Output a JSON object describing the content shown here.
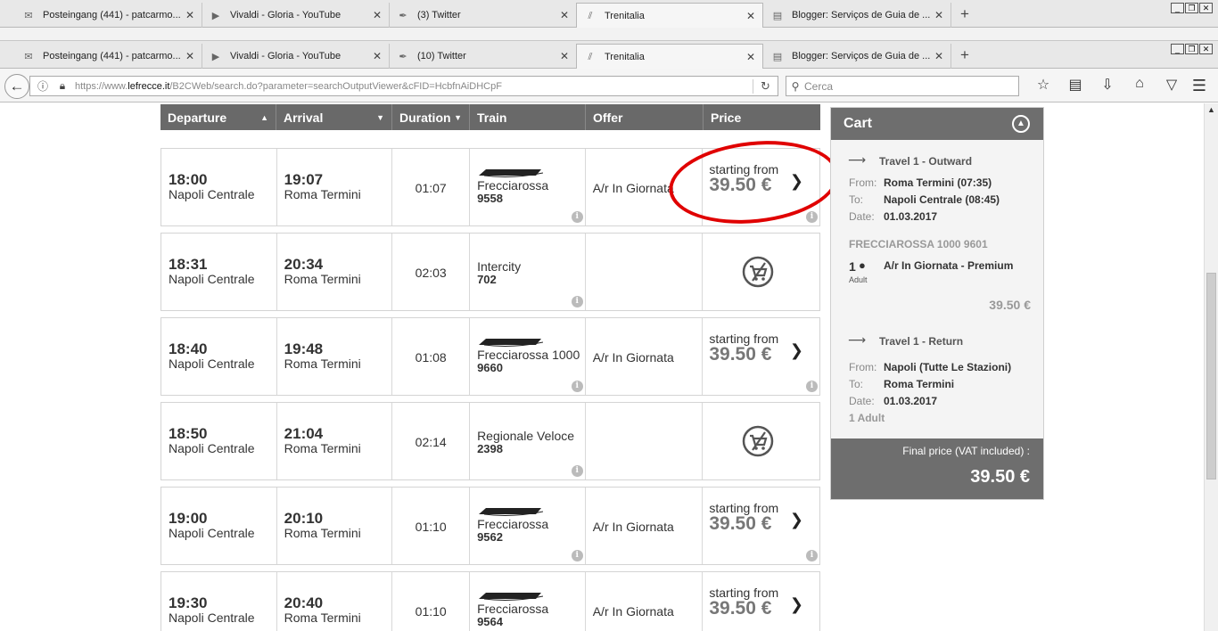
{
  "back_tabs": [
    {
      "title": "Posteingang (441) - patcarmo...",
      "icon": "mail-icon"
    },
    {
      "title": "Vivaldi - Gloria - YouTube",
      "icon": "video-icon"
    },
    {
      "title": "(3) Twitter",
      "icon": "twitter-icon"
    },
    {
      "title": "Trenitalia",
      "icon": "trenitalia-icon"
    },
    {
      "title": "Blogger: Serviços de Guia de ...",
      "icon": "blogger-icon"
    }
  ],
  "front_tabs": [
    {
      "title": "Posteingang (441) - patcarmo...",
      "icon": "mail-icon"
    },
    {
      "title": "Vivaldi - Gloria - YouTube",
      "icon": "video-icon"
    },
    {
      "title": "(10) Twitter",
      "icon": "twitter-icon"
    },
    {
      "title": "Trenitalia",
      "icon": "trenitalia-icon"
    },
    {
      "title": "Blogger: Serviços de Guia de ...",
      "icon": "blogger-icon"
    }
  ],
  "browser": {
    "url_prefix": "https://www.",
    "url_domain": "lefrecce.it",
    "url_rest": "/B2CWeb/search.do?parameter=searchOutputViewer&cFID=HcbfnAiDHCpF",
    "search_placeholder": "Cerca"
  },
  "table": {
    "headers": {
      "departure": "Departure",
      "arrival": "Arrival",
      "duration": "Duration",
      "train": "Train",
      "offer": "Offer",
      "price": "Price"
    },
    "rows": [
      {
        "dep_time": "18:00",
        "dep_station": "Napoli Centrale",
        "arr_time": "19:07",
        "arr_station": "Roma Termini",
        "duration": "01:07",
        "train_name": "Frecciarossa",
        "train_number": "9558",
        "offer": "A/r In Giornata",
        "price_label": "starting from",
        "price": "39.50 €",
        "bookable": true
      },
      {
        "dep_time": "18:31",
        "dep_station": "Napoli Centrale",
        "arr_time": "20:34",
        "arr_station": "Roma Termini",
        "duration": "02:03",
        "train_name": "Intercity",
        "train_number": "702",
        "offer": "",
        "price_label": "",
        "price": "",
        "bookable": false
      },
      {
        "dep_time": "18:40",
        "dep_station": "Napoli Centrale",
        "arr_time": "19:48",
        "arr_station": "Roma Termini",
        "duration": "01:08",
        "train_name": "Frecciarossa 1000",
        "train_number": "9660",
        "offer": "A/r In Giornata",
        "price_label": "starting from",
        "price": "39.50 €",
        "bookable": true
      },
      {
        "dep_time": "18:50",
        "dep_station": "Napoli Centrale",
        "arr_time": "21:04",
        "arr_station": "Roma Termini",
        "duration": "02:14",
        "train_name": "Regionale Veloce",
        "train_number": "2398",
        "offer": "",
        "price_label": "",
        "price": "",
        "bookable": false
      },
      {
        "dep_time": "19:00",
        "dep_station": "Napoli Centrale",
        "arr_time": "20:10",
        "arr_station": "Roma Termini",
        "duration": "01:10",
        "train_name": "Frecciarossa",
        "train_number": "9562",
        "offer": "A/r In Giornata",
        "price_label": "starting from",
        "price": "39.50 €",
        "bookable": true
      },
      {
        "dep_time": "19:30",
        "dep_station": "Napoli Centrale",
        "arr_time": "20:40",
        "arr_station": "Roma Termini",
        "duration": "01:10",
        "train_name": "Frecciarossa",
        "train_number": "9564",
        "offer": "A/r In Giornata",
        "price_label": "starting from",
        "price": "39.50 €",
        "bookable": true
      }
    ]
  },
  "cart": {
    "title": "Cart",
    "outward": {
      "heading": "Travel 1 - Outward",
      "from_label": "From:",
      "from": "Roma Termini (07:35)",
      "to_label": "To:",
      "to": "Napoli Centrale (08:45)",
      "date_label": "Date:",
      "date": "01.03.2017",
      "train": "FRECCIAROSSA 1000  9601",
      "pax_count": "1",
      "pax_type": "Adult",
      "offer": "A/r In Giornata  -  Premium",
      "price": "39.50 €"
    },
    "return": {
      "heading": "Travel 1 - Return",
      "from_label": "From:",
      "from": "Napoli (Tutte Le Stazioni)",
      "to_label": "To:",
      "to": "Roma Termini",
      "date_label": "Date:",
      "date": "01.03.2017",
      "pax": "1  Adult"
    },
    "final_label": "Final price (VAT included) :",
    "final_price": "39.50 €"
  }
}
